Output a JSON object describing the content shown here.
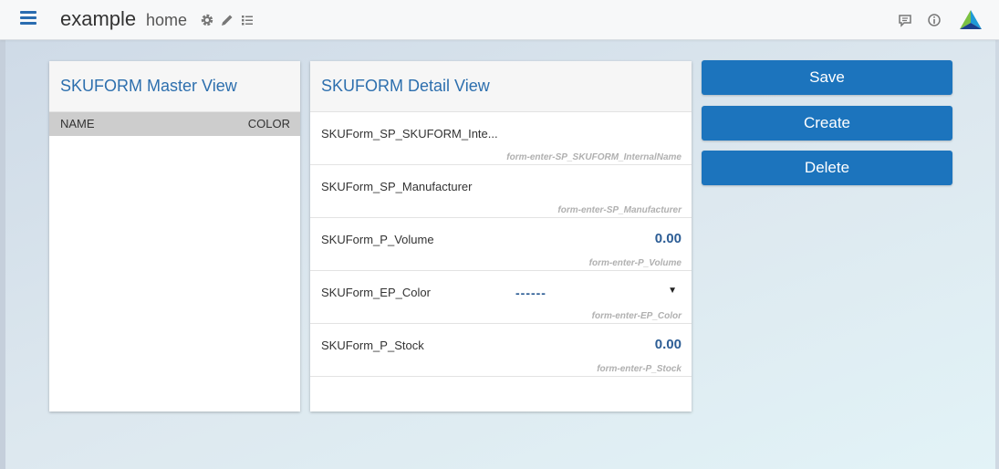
{
  "header": {
    "app_title": "example",
    "page_title": "home"
  },
  "master": {
    "title": "SKUFORM Master View",
    "columns": [
      "NAME",
      "COLOR"
    ]
  },
  "detail": {
    "title": "SKUFORM Detail View",
    "fields": [
      {
        "label": "SKUForm_SP_SKUFORM_Inte...",
        "value": "",
        "hint": "form-enter-SP_SKUFORM_InternalName"
      },
      {
        "label": "SKUForm_SP_Manufacturer",
        "value": "",
        "hint": "form-enter-SP_Manufacturer"
      },
      {
        "label": "SKUForm_P_Volume",
        "value": "0.00",
        "hint": "form-enter-P_Volume"
      },
      {
        "label": "SKUForm_EP_Color",
        "value": "------",
        "hint": "form-enter-EP_Color"
      },
      {
        "label": "SKUForm_P_Stock",
        "value": "0.00",
        "hint": "form-enter-P_Stock"
      }
    ]
  },
  "actions": {
    "save_label": "Save",
    "create_label": "Create",
    "delete_label": "Delete"
  },
  "colors": {
    "accent": "#1c74bd",
    "title_blue": "#2d6fae",
    "value_blue": "#2c5d95"
  },
  "icons": [
    "menu-icon",
    "gear-icon",
    "pencil-icon",
    "list-icon",
    "chat-icon",
    "info-icon",
    "app-logo"
  ]
}
